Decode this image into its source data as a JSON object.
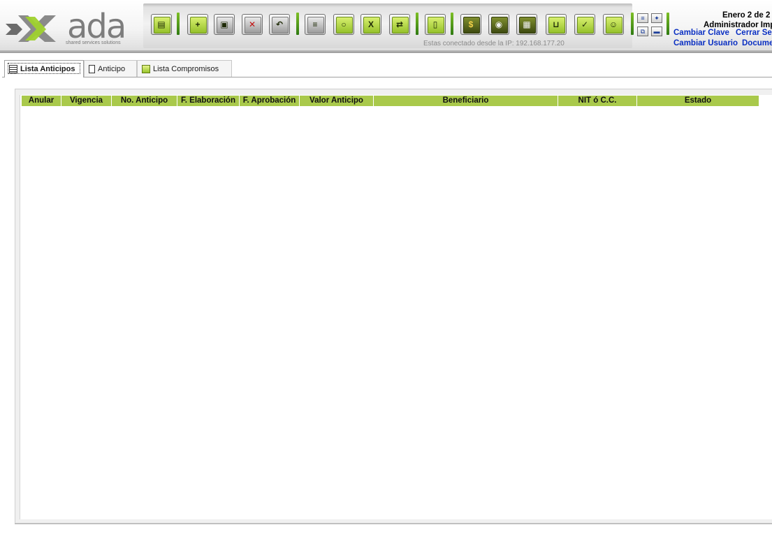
{
  "header": {
    "brand_name": "ada",
    "brand_tagline": "shared services solutions",
    "ip_text": "Estas conectado desde la IP: 192.168.177.20",
    "date_text": "Enero 2 de 2",
    "user_text": "Administrador Imp",
    "links": {
      "change_password": "Cambiar Clave",
      "close_session": "Cerrar Se",
      "change_user": "Cambiar Usuario",
      "documents": "Docume"
    }
  },
  "toolbar": {
    "buttons": [
      {
        "name": "open-folder",
        "glyph": "▤"
      },
      {
        "name": "new",
        "glyph": "+"
      },
      {
        "name": "save",
        "glyph": "▣"
      },
      {
        "name": "delete",
        "glyph": "✕"
      },
      {
        "name": "undo",
        "glyph": "↶"
      },
      {
        "name": "print",
        "glyph": "≡"
      },
      {
        "name": "search",
        "glyph": "○"
      },
      {
        "name": "export-excel",
        "glyph": "X"
      },
      {
        "name": "transfer",
        "glyph": "⇄"
      },
      {
        "name": "lock",
        "glyph": "▯"
      },
      {
        "name": "money",
        "glyph": "$"
      },
      {
        "name": "camera",
        "glyph": "◉"
      },
      {
        "name": "grid",
        "glyph": "▦"
      },
      {
        "name": "cart",
        "glyph": "⊔"
      },
      {
        "name": "approve",
        "glyph": "✓"
      },
      {
        "name": "users",
        "glyph": "☺"
      }
    ]
  },
  "tabs": [
    {
      "label": "Lista Anticipos",
      "active": true
    },
    {
      "label": "Anticipo",
      "active": false
    },
    {
      "label": "Lista Compromisos",
      "active": false
    }
  ],
  "grid": {
    "columns": [
      "Anular",
      "Vigencia",
      "No. Anticipo",
      "F. Elaboración",
      "F. Aprobación",
      "Valor Anticipo",
      "Beneficiario",
      "NIT ó C.C.",
      "Estado"
    ],
    "rows": []
  },
  "colors": {
    "header_green": "#a9c94b",
    "accent_green": "#2f7a12",
    "link_blue": "#0a2fc2"
  }
}
